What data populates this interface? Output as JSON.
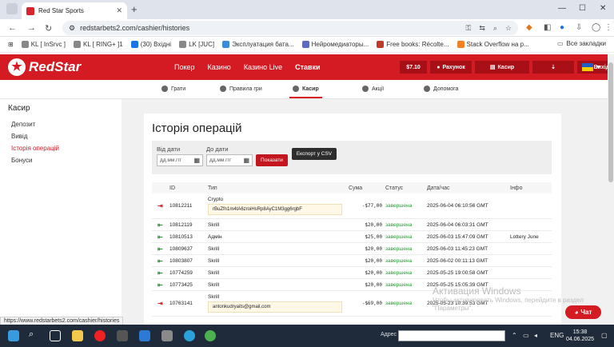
{
  "browser": {
    "tab_title": "Red Star Sports",
    "url": "redstarbets2.com/cashier/histories",
    "bookmarks": [
      "KL [ InSrvc ]",
      "KL [ RING+ ]1",
      "(30) Вхідні",
      "LK [JUC]",
      "Эксплуатация бата...",
      "Нейромедиаторы...",
      "Free books: Récolte...",
      "Stack Overflow на р..."
    ],
    "bookmarks_folder": "Все закладки",
    "status_url": "https://www.redstarbets2.com/cashier/histories"
  },
  "header": {
    "logo_text": "RedStar",
    "nav": [
      "Покер",
      "Казино",
      "Казино Live",
      "Ставки"
    ],
    "active_nav": "Ставки",
    "balance": "$7.10",
    "account": "Рахунок",
    "cashier": "Касир",
    "logout": "Вихід"
  },
  "subnav": {
    "items": [
      "Грати",
      "Правила гри",
      "Касир",
      "Акції",
      "Допомога"
    ]
  },
  "sidebar": {
    "title": "Касир",
    "links": [
      "Депозит",
      "Вивід",
      "Історія операцій",
      "Бонуси"
    ],
    "active": "Історія операцій"
  },
  "page": {
    "title": "Історія операцій",
    "filter": {
      "from_label": "Від дати",
      "to_label": "До дати",
      "from_placeholder": "дд.мм.ггг",
      "to_placeholder": "дд.мм.ггг",
      "show_button": "Показати",
      "export_button": "Експорт у CSV"
    },
    "table": {
      "headers": [
        "ID",
        "Тип",
        "Сума",
        "Статус",
        "Дата/час",
        "Інфо"
      ],
      "rows": [
        {
          "dir": "out",
          "id": "10812211",
          "type": "Crypto",
          "wallet": "rBuZfn1m4tA6zroiHsRp8AyC1M3gg6rgbF",
          "sum": "-$77,00",
          "status": "завершена",
          "date": "2025-06-04 06:10:56 GMT",
          "info": ""
        },
        {
          "dir": "in",
          "id": "10812119",
          "type": "Skrill",
          "wallet": "",
          "sum": "$20,00",
          "status": "завершена",
          "date": "2025-06-04 06:03:31 GMT",
          "info": ""
        },
        {
          "dir": "in",
          "id": "10810513",
          "type": "Адмін",
          "wallet": "",
          "sum": "$25,00",
          "status": "завершена",
          "date": "2025-06-03 15:47:09 GMT",
          "info": "Lottery June"
        },
        {
          "dir": "in",
          "id": "10809637",
          "type": "Skrill",
          "wallet": "",
          "sum": "$20,00",
          "status": "завершена",
          "date": "2025-06-03 11:45:23 GMT",
          "info": ""
        },
        {
          "dir": "in",
          "id": "10803807",
          "type": "Skrill",
          "wallet": "",
          "sum": "$20,00",
          "status": "завершена",
          "date": "2025-06-02 00:11:13 GMT",
          "info": ""
        },
        {
          "dir": "in",
          "id": "10774259",
          "type": "Skrill",
          "wallet": "",
          "sum": "$20,00",
          "status": "завершена",
          "date": "2025-05-25 19:00:58 GMT",
          "info": ""
        },
        {
          "dir": "in",
          "id": "10773425",
          "type": "Skrill",
          "wallet": "",
          "sum": "$20,00",
          "status": "завершена",
          "date": "2025-05-25 15:05:39 GMT",
          "info": ""
        },
        {
          "dir": "out",
          "id": "10763141",
          "type": "Skrill",
          "wallet": "antonkudryaits@gmail.com",
          "sum": "-$69,00",
          "status": "завершена",
          "date": "2025-05-23 10:39:53 GMT",
          "info": ""
        }
      ]
    }
  },
  "watermark": {
    "line1": "Активация Windows",
    "line2": "Чтобы активировать Windows, перейдите в раздел",
    "line3": "\"Параметры\"."
  },
  "chat_label": "Чат",
  "taskbar": {
    "addr_label": "Адрес",
    "lang": "ENG",
    "time": "15:38",
    "date": "04.06.2025"
  },
  "colors": {
    "brand": "#d41b24",
    "status_ok": "#2a9a35"
  }
}
